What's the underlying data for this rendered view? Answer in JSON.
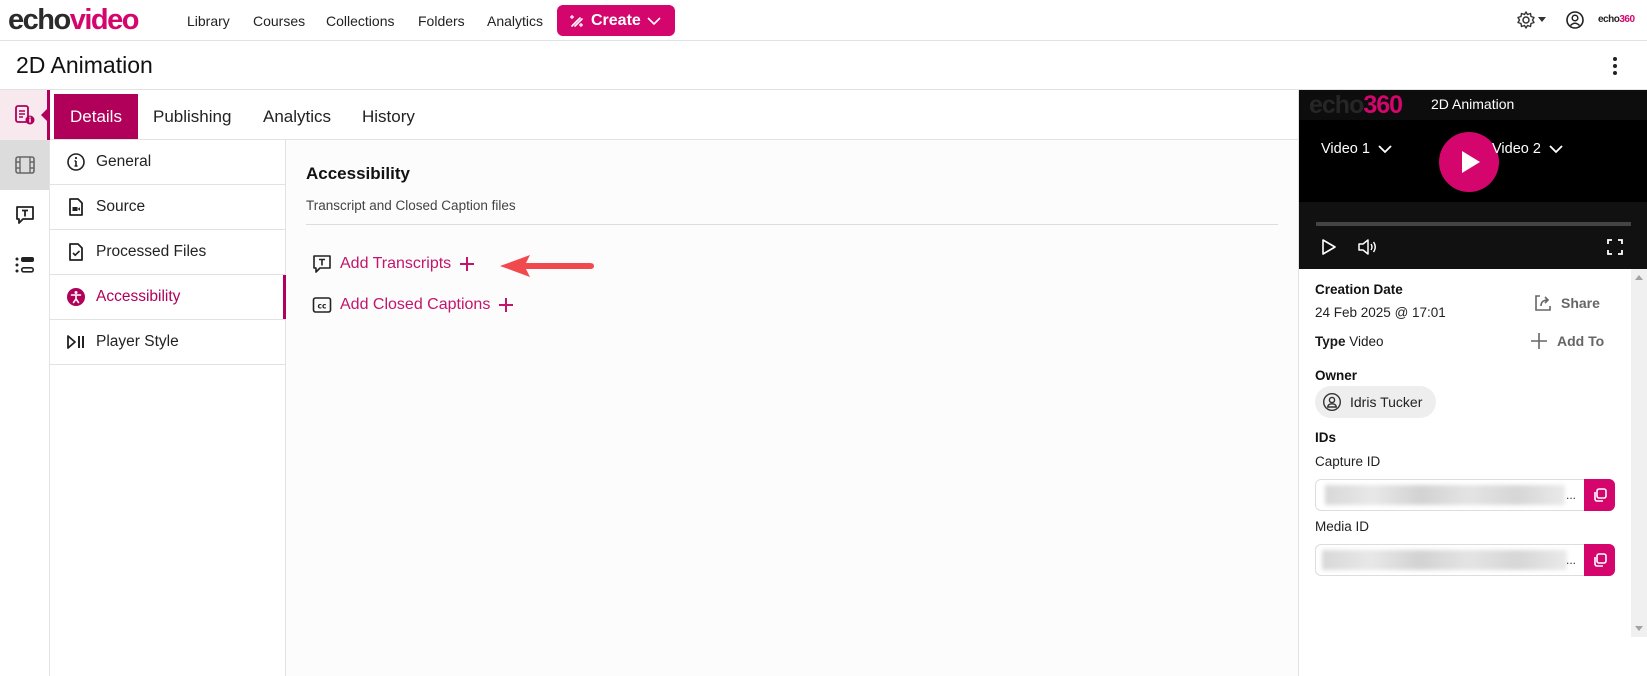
{
  "app": {
    "logo_part1": "echo",
    "logo_part2": "video",
    "brand_small_part1": "echo",
    "brand_small_part2": "360"
  },
  "topnav": {
    "links": [
      "Library",
      "Courses",
      "Collections",
      "Folders",
      "Analytics"
    ],
    "create_label": "Create",
    "settings_icon": "gear-icon",
    "user_icon": "user-circle-icon"
  },
  "page": {
    "title": "2D Animation"
  },
  "rail": {
    "items": [
      {
        "icon": "details-icon",
        "active": true
      },
      {
        "icon": "film-icon",
        "active": false
      },
      {
        "icon": "transcript-icon",
        "active": false
      },
      {
        "icon": "list-icon",
        "active": false
      }
    ]
  },
  "tabs": [
    {
      "label": "Details",
      "active": true
    },
    {
      "label": "Publishing",
      "active": false
    },
    {
      "label": "Analytics",
      "active": false
    },
    {
      "label": "History",
      "active": false
    }
  ],
  "subnav": [
    {
      "label": "General",
      "icon": "info-icon",
      "active": false
    },
    {
      "label": "Source",
      "icon": "video-file-icon",
      "active": false
    },
    {
      "label": "Processed Files",
      "icon": "file-check-icon",
      "active": false
    },
    {
      "label": "Accessibility",
      "icon": "accessibility-icon",
      "active": true
    },
    {
      "label": "Player Style",
      "icon": "play-pause-icon",
      "active": false
    }
  ],
  "content": {
    "section_title": "Accessibility",
    "section_subtitle": "Transcript and Closed Caption files",
    "actions": [
      {
        "label": "Add Transcripts",
        "icon": "transcript-icon"
      },
      {
        "label": "Add Closed Captions",
        "icon": "closed-captions-icon"
      }
    ]
  },
  "player": {
    "logo_part1": "echo",
    "logo_part2": "360",
    "title": "2D Animation",
    "video1_label": "Video 1",
    "video2_label": "Video 2",
    "progress": 0
  },
  "details": {
    "creation_date_label": "Creation Date",
    "creation_date": "24 Feb 2025 @ 17:01",
    "type_label": "Type",
    "type_value": "Video",
    "share_label": "Share",
    "add_to_label": "Add To",
    "owner_label": "Owner",
    "owner_name": "Idris Tucker",
    "ids_label": "IDs",
    "capture_id_label": "Capture ID",
    "media_id_label": "Media ID",
    "ellipsis": "..."
  },
  "colors": {
    "brand": "#d4066e",
    "accent_dark": "#b0005a"
  }
}
